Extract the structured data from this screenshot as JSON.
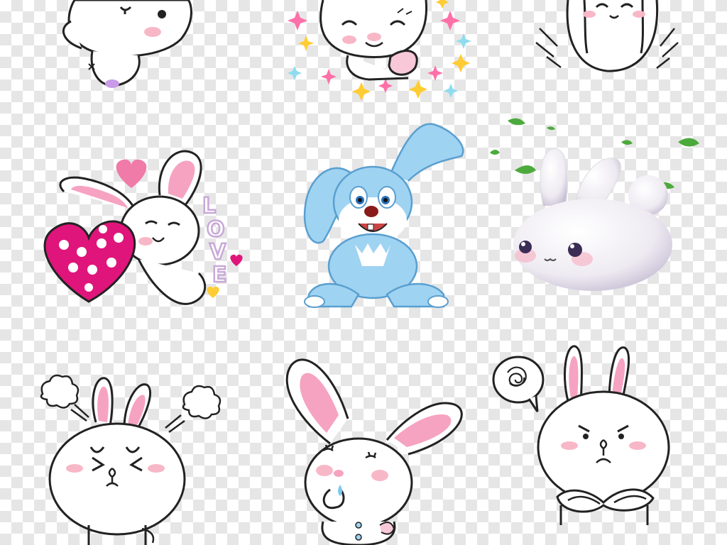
{
  "sheet": {
    "background": "transparency-checkerboard",
    "sticker_count": 9
  },
  "colors": {
    "outline": "#222222",
    "ear_pink": "#f6a3c2",
    "cheek_pink": "#f8b7c7",
    "heart_magenta": "#e0157b",
    "heart_pink": "#f07aa8",
    "blue_rabbit": "#9fd3f2",
    "leaf_green": "#4caa3c",
    "star_pink": "#ff6fa8",
    "star_yellow": "#ffcc33",
    "star_cyan": "#8fdcef"
  },
  "stickers": [
    {
      "name": "sleepy-rabbit-top-left"
    },
    {
      "name": "smug-rabbit-sparkles"
    },
    {
      "name": "rabbit-arms-up-cropped"
    },
    {
      "name": "rabbit-hugging-polka-heart"
    },
    {
      "name": "blue-cartoon-rabbit"
    },
    {
      "name": "fluffy-3d-rabbit-leaves"
    },
    {
      "name": "angry-steaming-rabbit"
    },
    {
      "name": "drooling-thinking-rabbit"
    },
    {
      "name": "grumpy-arms-crossed-rabbit"
    }
  ],
  "love_sticker": {
    "letters": [
      "L",
      "O",
      "V",
      "E"
    ]
  }
}
